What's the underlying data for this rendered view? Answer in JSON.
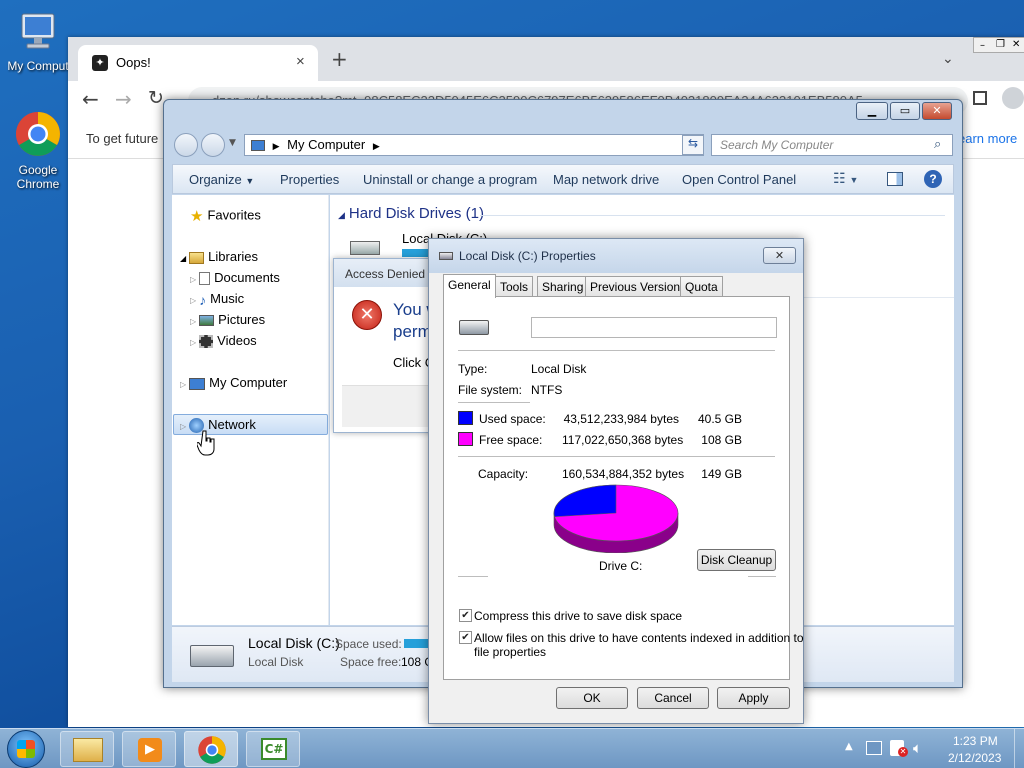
{
  "desktop": {
    "icons": [
      {
        "label": "My Comput"
      },
      {
        "label": "Google Chrome"
      }
    ]
  },
  "chrome": {
    "tab_title": "Oops!",
    "url": "dzen.ru/showcaptcha?mt=98C58EC22D5045E6C2590C6797E6B5639586EF0B4021809EA34A633101EB580A5",
    "infobar_text": "To get future",
    "learn_more": "earn more"
  },
  "explorer": {
    "breadcrumb": "My Computer",
    "search_placeholder": "Search My Computer",
    "commands": [
      "Organize",
      "Properties",
      "Uninstall or change a program",
      "Map network drive",
      "Open Control Panel"
    ],
    "nav": {
      "favorites": "Favorites",
      "libraries": "Libraries",
      "library_items": [
        "Documents",
        "Music",
        "Pictures",
        "Videos"
      ],
      "computer": "My Computer",
      "network": "Network"
    },
    "group_header": "Hard Disk Drives (1)",
    "drive_partial": "Local Disk (C:)",
    "details": {
      "name": "Local Disk (C:)",
      "type": "Local Disk",
      "space_used_label": "Space used:",
      "space_free_label": "Space free:",
      "space_free_value": "108 G"
    }
  },
  "access_denied": {
    "title": "Access Denied",
    "message_line1": "You w",
    "message_line2": "perm",
    "click_text": "Click C"
  },
  "properties": {
    "title": "Local Disk (C:) Properties",
    "tabs": [
      "General",
      "Tools",
      "Sharing",
      "Previous Versions",
      "Quota"
    ],
    "name_field": "",
    "type_label": "Type:",
    "type_value": "Local Disk",
    "fs_label": "File system:",
    "fs_value": "NTFS",
    "used_label": "Used space:",
    "used_bytes": "43,512,233,984 bytes",
    "used_gb": "40.5 GB",
    "free_label": "Free space:",
    "free_bytes": "117,022,650,368 bytes",
    "free_gb": "108 GB",
    "capacity_label": "Capacity:",
    "capacity_bytes": "160,534,884,352 bytes",
    "capacity_gb": "149 GB",
    "drive_label": "Drive C:",
    "disk_cleanup": "Disk Cleanup",
    "compress_label": "Compress this drive to save disk space",
    "compress_checked": true,
    "index_label_line1": "Allow files on this drive to have contents indexed in addition to",
    "index_label_line2": "file properties",
    "index_checked": true,
    "used_fraction": 0.271,
    "used_color": "#0000ff",
    "free_color": "#ff00ff",
    "ok": "OK",
    "cancel": "Cancel",
    "apply": "Apply"
  },
  "taskbar": {
    "time": "1:23 PM",
    "date": "2/12/2023",
    "csharp_label": "C#"
  }
}
